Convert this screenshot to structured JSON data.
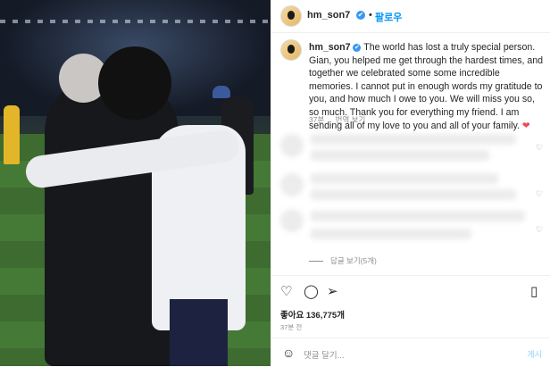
{
  "post": {
    "username": "hm_son7",
    "verified_glyph": "✔",
    "follow_label": "팔로우",
    "separator": "•",
    "caption": "The world has lost a truly special person. Gian, you helped me get through the hardest times, and together we celebrated some some incredible memories. I cannot put in enough words my gratitude to you, and how much I owe to you. We will miss you so, so much. Thank you for everything my friend. I am sending all of my love to you and all of your family.",
    "caption_emoji": "❤",
    "time_ago": "37분",
    "translate_label": "번역 보기",
    "replies_label": "답글 보기(5개)",
    "likes": "좋아요 136,775개",
    "time_ago_small": "37분 전",
    "comment_placeholder": "댓글 달기...",
    "post_label": "게시"
  },
  "icons": {
    "like": "heart-icon",
    "comment": "comment-icon",
    "share": "share-icon",
    "save": "bookmark-icon",
    "emoji": "emoji-icon",
    "comment_like": "heart-icon"
  },
  "colors": {
    "accent": "#0095f6",
    "verified": "#3897f0",
    "heart": "#ed4956",
    "muted": "#8e8e8e"
  }
}
